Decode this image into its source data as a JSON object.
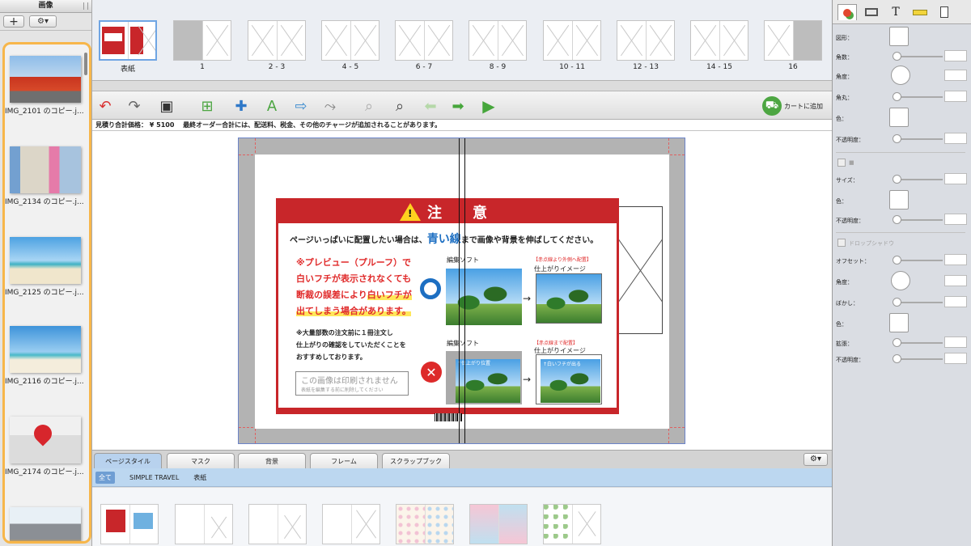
{
  "left_panel": {
    "title": "画像",
    "add_label": "+",
    "gear_label": "⚙▾",
    "images": [
      {
        "caption": "IMG_2101 のコピー.j..."
      },
      {
        "caption": "IMG_2134 のコピー.j..."
      },
      {
        "caption": "IMG_2125 のコピー.j..."
      },
      {
        "caption": "IMG_2116 のコピー.j..."
      },
      {
        "caption": "IMG_2174 のコピー.j..."
      }
    ],
    "collapse_glyph": "«",
    "highlight_color": "#f7b64a"
  },
  "page_strip": {
    "pages": [
      {
        "label": "表紙",
        "selected": true
      },
      {
        "label": "1"
      },
      {
        "label": "2 - 3"
      },
      {
        "label": "4 - 5"
      },
      {
        "label": "6 - 7"
      },
      {
        "label": "8 - 9"
      },
      {
        "label": "10 - 11"
      },
      {
        "label": "12 - 13"
      },
      {
        "label": "14 - 15"
      },
      {
        "label": "16"
      }
    ]
  },
  "toolbar": {
    "cart_label": "カートに追加",
    "icons": [
      "undo-icon",
      "redo-icon",
      "save-icon",
      "add-page-icon",
      "add-image-icon",
      "add-text-icon",
      "export-icon",
      "import-icon",
      "zoom-out-icon",
      "zoom-in-icon",
      "back-arrow-icon",
      "forward-arrow-icon",
      "play-icon"
    ]
  },
  "price_bar": {
    "text": "見積り合計価格： ¥ 5100　 最終オーダー合計には、配送料、税金、その他のチャージが追加されることがあります。"
  },
  "notice": {
    "title": "注　意",
    "headline_pre": "ページいっぱいに配置したい場合は、",
    "headline_highlight": "青い線",
    "headline_post": "まで画像や背景を伸ばしてください。",
    "red_lines": [
      "※プレビュー（プルーフ）で",
      "白いフチが表示されなくても",
      "断裁の誤差により",
      "白いフチが",
      "出てしまう場合があります。"
    ],
    "black_lines": [
      "※大量部数の注文前に１冊注文し",
      "仕上がりの確認をしていただくことを",
      "おすすめしております。"
    ],
    "not_printed_title": "この画像は印刷されません",
    "not_printed_sub": "表紙を編集する前に削除してください",
    "good_label_soft": "編集ソフト",
    "good_label_red": "【赤点線より外側へ配置】",
    "good_label_finish": "仕上がりイメージ",
    "bad_label_soft": "編集ソフト",
    "bad_label_red": "【赤点線まで配置】",
    "bad_label_finish": "仕上がりイメージ",
    "bad_photo_text": "↑仕上がり位置",
    "bad_result_text": "↑白いフチが出る",
    "accent_red": "#c8262a",
    "accent_blue": "#1d6fc2"
  },
  "tabs": {
    "items": [
      {
        "label": "ページスタイル",
        "active": true
      },
      {
        "label": "マスク"
      },
      {
        "label": "背景"
      },
      {
        "label": "フレーム"
      },
      {
        "label": "スクラップブック"
      }
    ],
    "gear_label": "⚙▾"
  },
  "filters": {
    "items": [
      "全て",
      "SIMPLE TRAVEL",
      "表紙"
    ]
  },
  "inspector": {
    "tabs": [
      "shape-tab-icon",
      "frame-tab-icon",
      "T",
      "ruler-tab-icon",
      "page-tab-icon"
    ],
    "text_tab_label": "T",
    "rows_top": [
      {
        "label": "図形：",
        "kind": "swatch"
      },
      {
        "label": "角数：",
        "kind": "slider"
      },
      {
        "label": "角度：",
        "kind": "dial"
      },
      {
        "label": "角丸：",
        "kind": "slider"
      },
      {
        "label": "色：",
        "kind": "swatch"
      },
      {
        "label": "不透明度：",
        "kind": "slider"
      }
    ],
    "border_checkbox_label": "■",
    "rows_border": [
      {
        "label": "サイズ：",
        "kind": "slider"
      },
      {
        "label": "色：",
        "kind": "swatch"
      },
      {
        "label": "不透明度：",
        "kind": "slider"
      }
    ],
    "shadow_checkbox_label": "ドロップシャドウ",
    "rows_shadow": [
      {
        "label": "オフセット：",
        "kind": "slider"
      },
      {
        "label": "角度：",
        "kind": "dial"
      },
      {
        "label": "ぼかし：",
        "kind": "slider"
      },
      {
        "label": "色：",
        "kind": "swatch"
      },
      {
        "label": "拡張：",
        "kind": "slider"
      },
      {
        "label": "不透明度：",
        "kind": "slider"
      }
    ]
  }
}
